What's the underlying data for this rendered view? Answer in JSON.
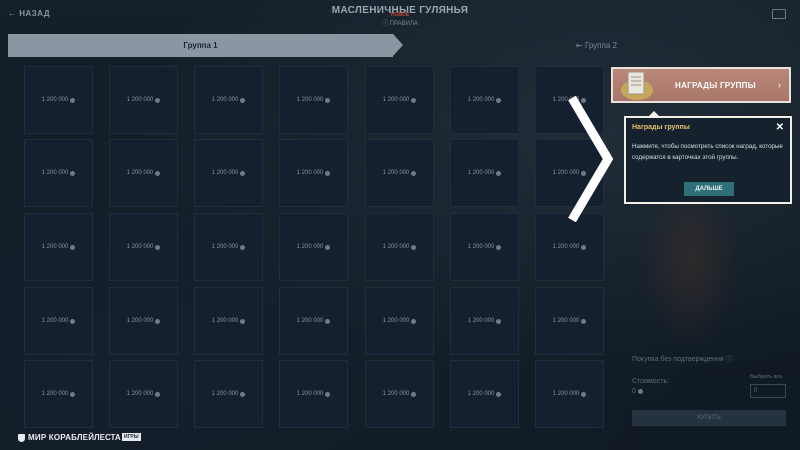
{
  "header": {
    "back_label": "НАЗАД",
    "title": "МАСЛЕНИЧНЫЕ ГУЛЯНЬЯ",
    "subtitle": "ПРАВИЛА",
    "new_badge": "НОВОЕ"
  },
  "tabs": [
    {
      "label": "Группа 1",
      "active": true
    },
    {
      "label": "Группа 2",
      "active": false
    }
  ],
  "grid": {
    "rows": 5,
    "cols": 7,
    "cell_price": "1 200 000"
  },
  "rewards_button": {
    "label": "НАГРАДЫ ГРУППЫ",
    "arrow": "›"
  },
  "tooltip": {
    "title": "Награды группы",
    "body": "Нажмите, чтобы посмотреть список наград, которые содержатся в карточках этой группы.",
    "next_label": "ДАЛЬШЕ",
    "close": "✕"
  },
  "purchase": {
    "no_confirm_label": "Покупка без подтверждения",
    "cost_label": "Стоимость:",
    "cost_value": "0",
    "select_label": "Выбрать все",
    "qty_value": "0",
    "buy_label": "КУПИТЬ"
  },
  "footer": {
    "logo1": "МИР КОРАБЛЕЙ",
    "logo2": "ЛЕСТА",
    "tag": "ИГРЫ"
  },
  "colors": {
    "accent_rewards": "#b9887a",
    "tooltip_title": "#e8c06a",
    "next_button": "#2e6f78"
  }
}
